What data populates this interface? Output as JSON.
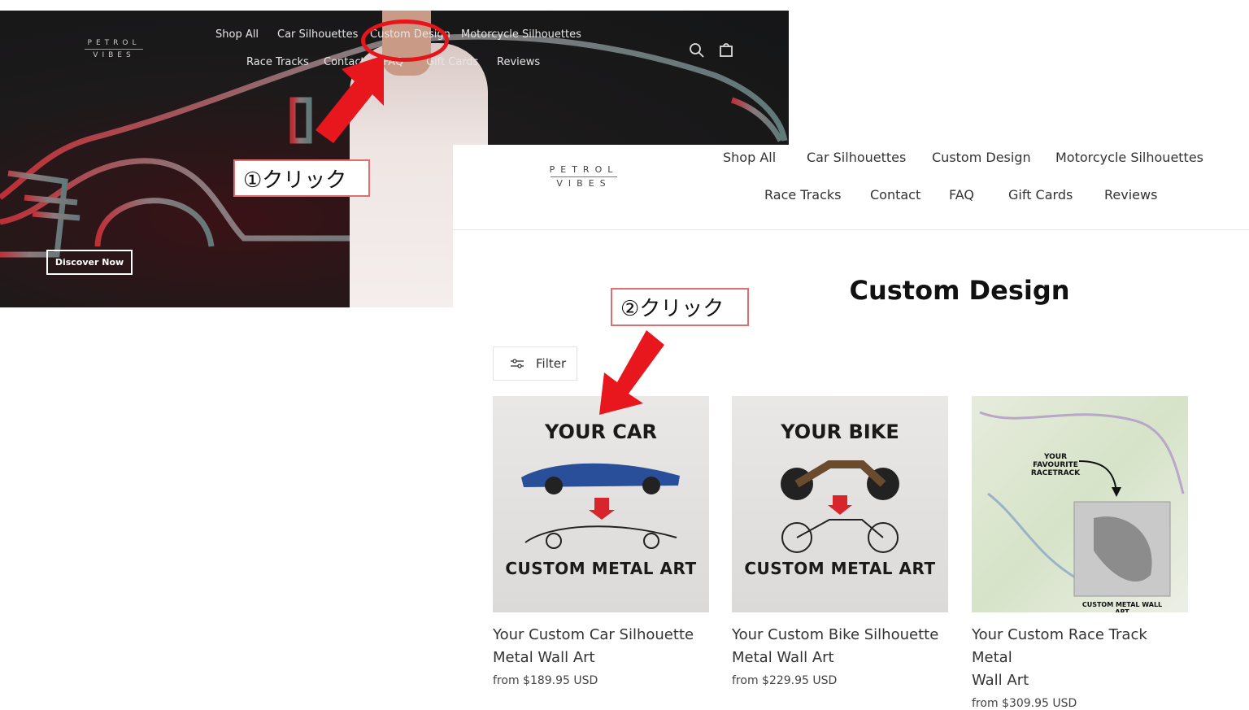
{
  "hero": {
    "logo_top": "PETROL",
    "logo_bottom": "VIBES",
    "nav": [
      "Shop All",
      "Car Silhouettes",
      "Custom Design",
      "Motorcycle Silhouettes",
      "Race Tracks",
      "Contact",
      "FAQ",
      "Gift Cards",
      "Reviews"
    ],
    "cta_label": "Discover Now",
    "icons": [
      "search-icon",
      "cart-icon"
    ]
  },
  "site": {
    "logo_top": "PETROL",
    "logo_bottom": "VIBES",
    "nav": [
      "Shop All",
      "Car Silhouettes",
      "Custom Design",
      "Motorcycle Silhouettes",
      "Race Tracks",
      "Contact",
      "FAQ",
      "Gift Cards",
      "Reviews"
    ],
    "page_title": "Custom Design",
    "filter_label": "Filter",
    "products": [
      {
        "image_top": "YOUR CAR",
        "image_bottom": "CUSTOM METAL ART",
        "title_line1": "Your Custom Car Silhouette",
        "title_line2": "Metal Wall Art",
        "price": "from $189.95 USD"
      },
      {
        "image_top": "YOUR BIKE",
        "image_bottom": "CUSTOM METAL ART",
        "title_line1": "Your Custom Bike Silhouette",
        "title_line2": "Metal Wall Art",
        "price": "from $229.95 USD"
      },
      {
        "image_top": "YOUR FAVOURITE RACETRACK",
        "image_bottom": "CUSTOM METAL WALL ART",
        "title_line1": "Your Custom Race Track Metal",
        "title_line2": "Wall Art",
        "price": "from $309.95 USD"
      }
    ]
  },
  "annotations": {
    "step1": "①クリック",
    "step2": "②クリック",
    "accent_color": "#e6141b"
  }
}
